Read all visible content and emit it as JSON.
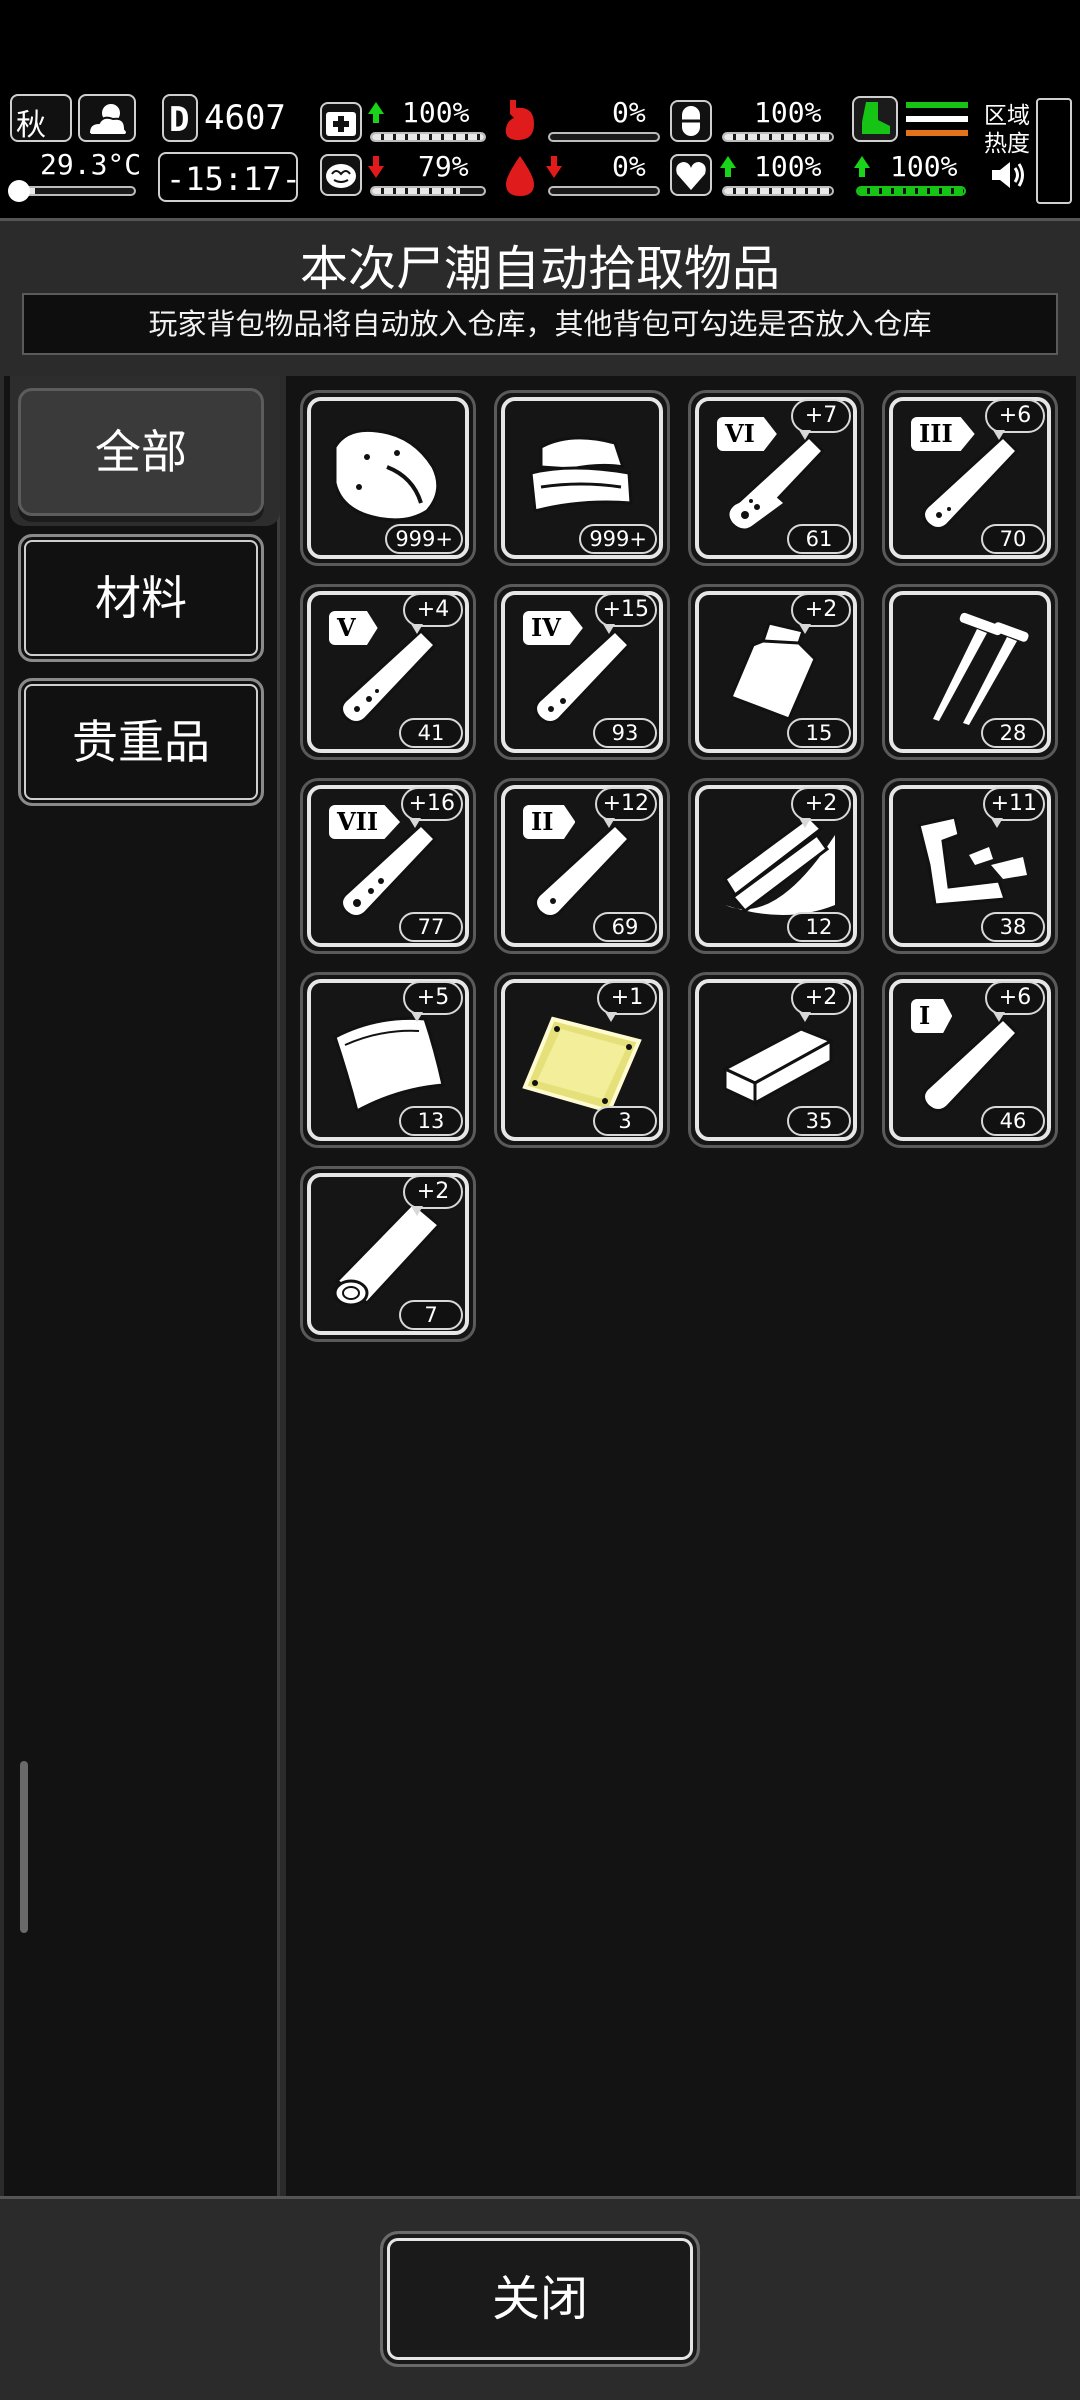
{
  "hud": {
    "season": "秋",
    "temperature": "29.3°C",
    "day_prefix": "D",
    "day": "4607",
    "clock": "-15:17-",
    "stats": {
      "health": "100%",
      "hunger": "0%",
      "medicine": "100%",
      "stamina": "100%",
      "sanity": "79%",
      "bleeding": "0%",
      "heart": "100%",
      "speed": "100%"
    },
    "area_heat_label": "区域热度"
  },
  "panel": {
    "title": "本次尸潮自动拾取物品",
    "subtitle": "玩家背包物品将自动放入仓库，其他背包可勾选是否放入仓库"
  },
  "sidebar": {
    "tabs": [
      {
        "label": "全部",
        "active": true
      },
      {
        "label": "材料",
        "active": false
      },
      {
        "label": "贵重品",
        "active": false
      }
    ]
  },
  "items": [
    {
      "icon": "raw-meat-icon",
      "count": "999+",
      "plus": ""
    },
    {
      "icon": "cloth-icon",
      "count": "999+",
      "plus": ""
    },
    {
      "icon": "test-tube-icon",
      "tier": "VI",
      "count": "61",
      "plus": "+7"
    },
    {
      "icon": "test-tube-icon",
      "tier": "III",
      "count": "70",
      "plus": "+6"
    },
    {
      "icon": "test-tube-icon",
      "tier": "V",
      "count": "41",
      "plus": "+4"
    },
    {
      "icon": "test-tube-icon",
      "tier": "IV",
      "count": "93",
      "plus": "+15"
    },
    {
      "icon": "pouch-icon",
      "count": "15",
      "plus": "+2"
    },
    {
      "icon": "nails-icon",
      "count": "28",
      "plus": ""
    },
    {
      "icon": "test-tube-icon",
      "tier": "VII",
      "count": "77",
      "plus": "+16"
    },
    {
      "icon": "test-tube-icon",
      "tier": "II",
      "count": "69",
      "plus": "+12"
    },
    {
      "icon": "wood-planks-icon",
      "count": "12",
      "plus": "+2"
    },
    {
      "icon": "scrap-metal-icon",
      "count": "38",
      "plus": "+11"
    },
    {
      "icon": "leather-icon",
      "count": "13",
      "plus": "+5"
    },
    {
      "icon": "gold-plate-icon",
      "count": "3",
      "plus": "+1"
    },
    {
      "icon": "brick-icon",
      "count": "35",
      "plus": "+2"
    },
    {
      "icon": "test-tube-icon",
      "tier": "I",
      "count": "46",
      "plus": "+6"
    },
    {
      "icon": "wood-log-icon",
      "count": "7",
      "plus": "+2"
    }
  ],
  "footer": {
    "close_label": "关闭"
  }
}
